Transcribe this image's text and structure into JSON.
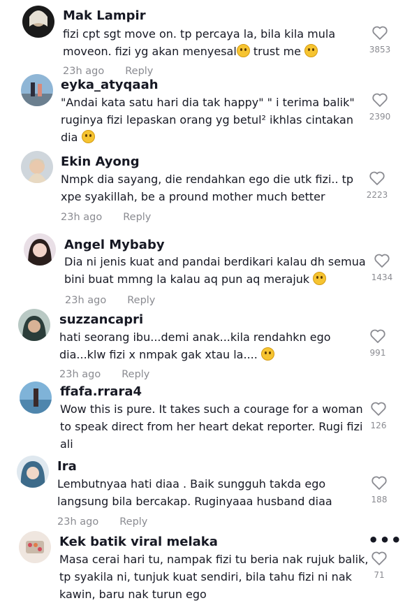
{
  "comments": [
    {
      "username": "Mak Lampir",
      "lines": [
        "fizi cpt sgt move on. tp percaya la, bila kila mula",
        "moveon. fizi yg akan menyesal",
        " trust me "
      ],
      "time": "23h ago",
      "reply": "Reply",
      "likes": "3853"
    },
    {
      "username": "eyka_atyqaah",
      "lines": [
        "\"Andai kata satu hari dia tak happy\" \" i terima balik\"",
        "ruginya fizi lepaskan orang yg betul² ikhlas cintakan",
        "dia "
      ],
      "likes": "2390"
    },
    {
      "username": "Ekin Ayong",
      "lines": [
        "Nmpk dia sayang, die rendahkan ego die utk fizi.. tp",
        "xpe syakillah, be a pround mother much better"
      ],
      "time": "23h ago",
      "reply": "Reply",
      "likes": "2223"
    },
    {
      "username": "Angel Mybaby",
      "lines": [
        "Dia ni jenis kuat and pandai berdikari kalau dh semua",
        "bini buat mmng la kalau aq pun aq merajuk "
      ],
      "time": "23h ago",
      "reply": "Reply",
      "likes": "1434"
    },
    {
      "username": "suzzancapri",
      "lines": [
        "hati seorang ibu...demi anak...kila rendahkn ego",
        "dia...klw fizi x nmpak gak xtau la.... "
      ],
      "time": "23h ago",
      "reply": "Reply",
      "likes": "991"
    },
    {
      "username": "ffafa.rrara4",
      "lines": [
        "Wow this is pure. It takes such a courage for a woman",
        "to speak direct from her heart dekat reporter. Rugi fizi",
        "ali"
      ],
      "likes": "126"
    },
    {
      "username": "Ira",
      "lines": [
        "Lembutnyaa hati diaa . Baik sungguh takda ego",
        "langsung bila bercakap. Ruginyaaa husband diaa"
      ],
      "time": "23h ago",
      "reply": "Reply",
      "likes": "188"
    },
    {
      "username": "Kek batik viral melaka",
      "lines": [
        "Masa cerai hari tu, nampak fizi tu beria nak rujuk balik,",
        "tp syakila ni, tunjuk kuat sendiri, bila tahu fizi ni nak",
        "kawin, baru nak turun ego"
      ],
      "likes": "71"
    }
  ],
  "more_menu": "•••",
  "icons": {
    "like": "heart-outline-icon",
    "more": "more-options-icon"
  }
}
